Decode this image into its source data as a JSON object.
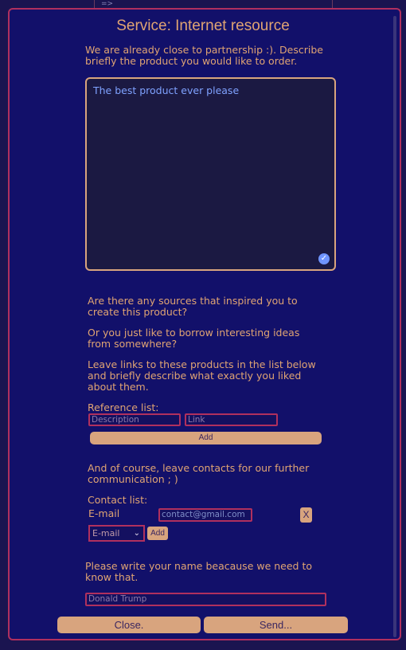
{
  "background": {
    "code_snippet": "=>"
  },
  "modal": {
    "title": "Service: Internet resource",
    "intro": "We are already close to partnership :). Describe briefly the product you would like to order.",
    "product_description": "The best product ever please",
    "questions": [
      "Are there any sources that inspired you to create this product?",
      "Or you just like to borrow interesting ideas from somewhere?",
      "Leave links to these products in the list below and briefly describe what exactly you liked about them."
    ],
    "reference_list": {
      "label": "Reference list:",
      "description_placeholder": "Description",
      "link_placeholder": "Link",
      "add_label": "Add"
    },
    "contacts": {
      "intro": "And of course, leave contacts for our further communication ; )",
      "label": "Contact list:",
      "entries": [
        {
          "type": "E-mail",
          "value": "contact@gmail.com",
          "remove_label": "X"
        }
      ],
      "type_select": "E-mail",
      "add_label": "Add"
    },
    "name": {
      "question": "Please write your name beacause we need to know that.",
      "value": "Donald Trump"
    },
    "footer": {
      "close_label": "Close.",
      "send_label": "Send..."
    }
  },
  "colors": {
    "accent": "#e0a473",
    "border": "#b0305e",
    "modal_bg": "#12106a",
    "button_bg": "#d8a47e",
    "link_text": "#7fa2ff"
  },
  "icons": {
    "check": "check-circle-icon",
    "select_arrow": "chevron-down-icon"
  }
}
